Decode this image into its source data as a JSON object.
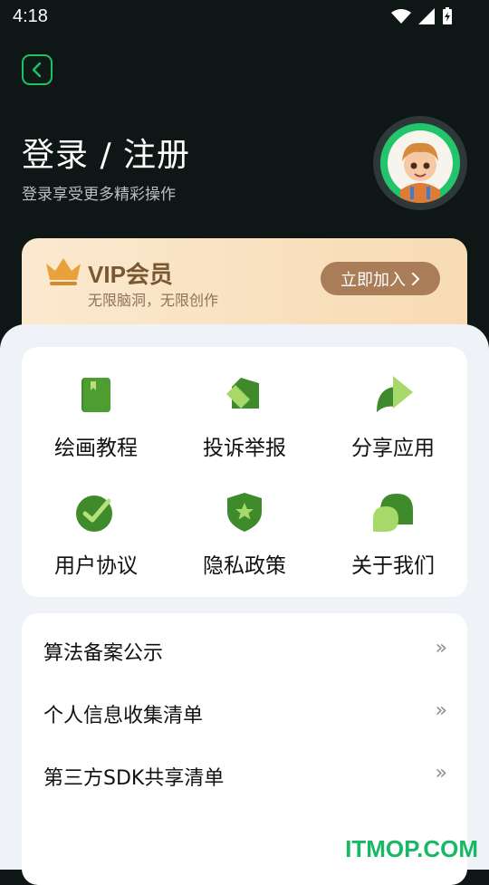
{
  "status_bar": {
    "time": "4:18"
  },
  "header": {
    "title": "登录 / 注册",
    "subtitle": "登录享受更多精彩操作"
  },
  "vip": {
    "title": "VIP会员",
    "description": "无限脑洞，无限创作",
    "join_label": "立即加入"
  },
  "grid": {
    "items": [
      {
        "label": "绘画教程",
        "icon": "book-icon"
      },
      {
        "label": "投诉举报",
        "icon": "report-icon"
      },
      {
        "label": "分享应用",
        "icon": "share-icon"
      },
      {
        "label": "用户协议",
        "icon": "check-circle-icon"
      },
      {
        "label": "隐私政策",
        "icon": "shield-star-icon"
      },
      {
        "label": "关于我们",
        "icon": "about-icon"
      }
    ]
  },
  "list": {
    "items": [
      {
        "label": "算法备案公示"
      },
      {
        "label": "个人信息收集清单"
      },
      {
        "label": "第三方SDK共享清单"
      }
    ]
  },
  "watermark": {
    "text": "ITMOP.COM"
  },
  "colors": {
    "accent": "#1ec16a",
    "dark_bg": "#0f1616",
    "vip_button": "#a97d57",
    "panel_bg": "#eff2f7"
  }
}
